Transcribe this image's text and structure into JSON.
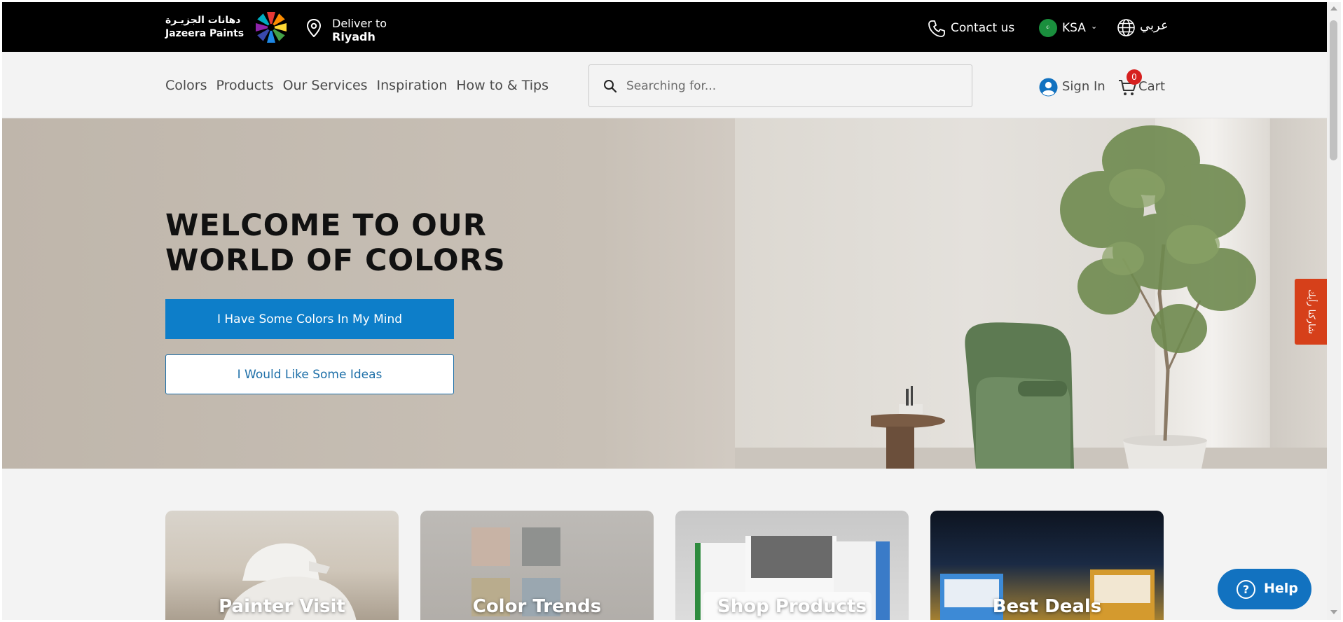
{
  "topbar": {
    "logo_arabic": "دهانات الجزيـرة",
    "logo_english": "Jazeera Paints",
    "deliver_label": "Deliver to",
    "deliver_city": "Riyadh",
    "contact_label": "Contact us",
    "country_code": "KSA",
    "language_label": "عربي"
  },
  "nav": {
    "items": [
      {
        "label": "Colors"
      },
      {
        "label": "Products"
      },
      {
        "label": "Our Services"
      },
      {
        "label": "Inspiration"
      },
      {
        "label": "How to & Tips"
      }
    ],
    "search_placeholder": "Searching for...",
    "signin_label": "Sign In",
    "cart_label": "Cart",
    "cart_count": "0"
  },
  "hero": {
    "title_line1": "WELCOME TO OUR",
    "title_line2": "WORLD OF COLORS",
    "primary_button": "I Have Some Colors In My Mind",
    "secondary_button": "I Would Like Some Ideas"
  },
  "feedback_tab": "شاركنا رأيك",
  "cards": [
    {
      "title": "Painter Visit"
    },
    {
      "title": "Color Trends"
    },
    {
      "title": "Shop Products"
    },
    {
      "title": "Best Deals"
    }
  ],
  "help_label": "Help",
  "colors": {
    "topbar_bg": "#000000",
    "primary_blue": "#0d7ec9",
    "feedback_orange": "#d6401a",
    "badge_red": "#d6201f"
  }
}
